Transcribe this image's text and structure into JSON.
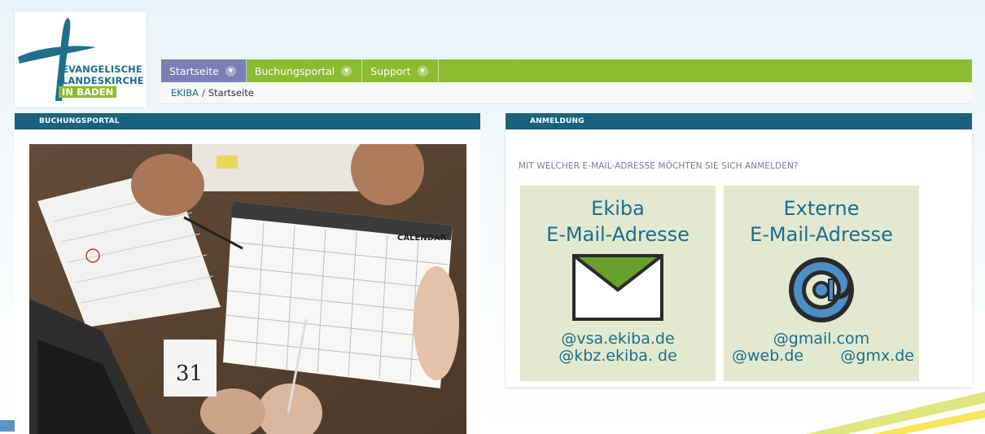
{
  "logo": {
    "line1": "EVANGELISCHE",
    "line2": "LANDESKIRCHE",
    "line3": "IN BADEN"
  },
  "nav": {
    "items": [
      {
        "label": "Startseite"
      },
      {
        "label": "Buchungsportal"
      },
      {
        "label": "Support"
      }
    ]
  },
  "breadcrumb": {
    "link": "EKIBA",
    "separator": "/",
    "current": "Startseite"
  },
  "left_panel": {
    "title": "BUCHUNGSPORTAL",
    "image_subject": "calendar-desk-photo"
  },
  "right_panel": {
    "title": "ANMELDUNG",
    "question": "MIT WELCHER E-MAIL-ADRESSE MÖCHTEN SIE SICH ANMELDEN?",
    "tiles": [
      {
        "title_line1": "Ekiba",
        "title_line2": "E-Mail-Adresse",
        "icon": "envelope-icon",
        "domain1": "@vsa.ekiba.de",
        "domain2": "@kbz.ekiba. de"
      },
      {
        "title_line1": "Externe",
        "title_line2": "E-Mail-Adresse",
        "icon": "at-sign-icon",
        "domain1": "@gmail.com",
        "domain2a": "@web.de",
        "domain2b": "@gmx.de"
      }
    ]
  },
  "colors": {
    "nav_green": "#8dbb2f",
    "nav_active": "#7a7fb8",
    "header_teal": "#19617d",
    "tile_bg": "#e3e8d1",
    "tile_text": "#1e6d8c",
    "question_text": "#7b78a8"
  }
}
